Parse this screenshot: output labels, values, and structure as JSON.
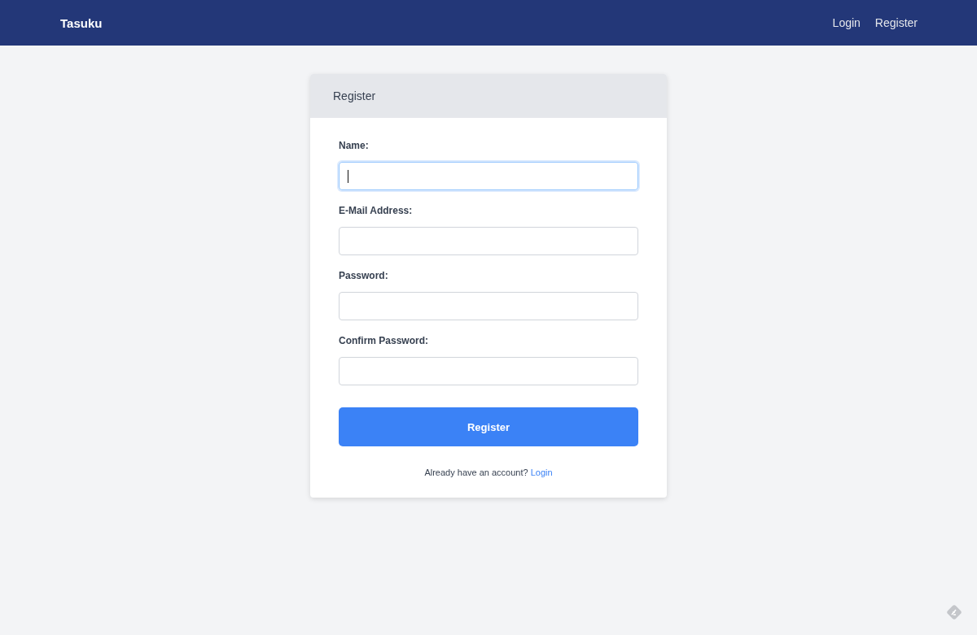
{
  "navbar": {
    "brand": "Tasuku",
    "links": [
      {
        "label": "Login"
      },
      {
        "label": "Register"
      }
    ]
  },
  "card": {
    "title": "Register",
    "fields": [
      {
        "label": "Name:",
        "focused": true
      },
      {
        "label": "E-Mail Address:",
        "focused": false
      },
      {
        "label": "Password:",
        "focused": false
      },
      {
        "label": "Confirm Password:",
        "focused": false
      }
    ],
    "submit": "Register",
    "footer": {
      "text": "Already have an account?",
      "link": "Login"
    }
  }
}
